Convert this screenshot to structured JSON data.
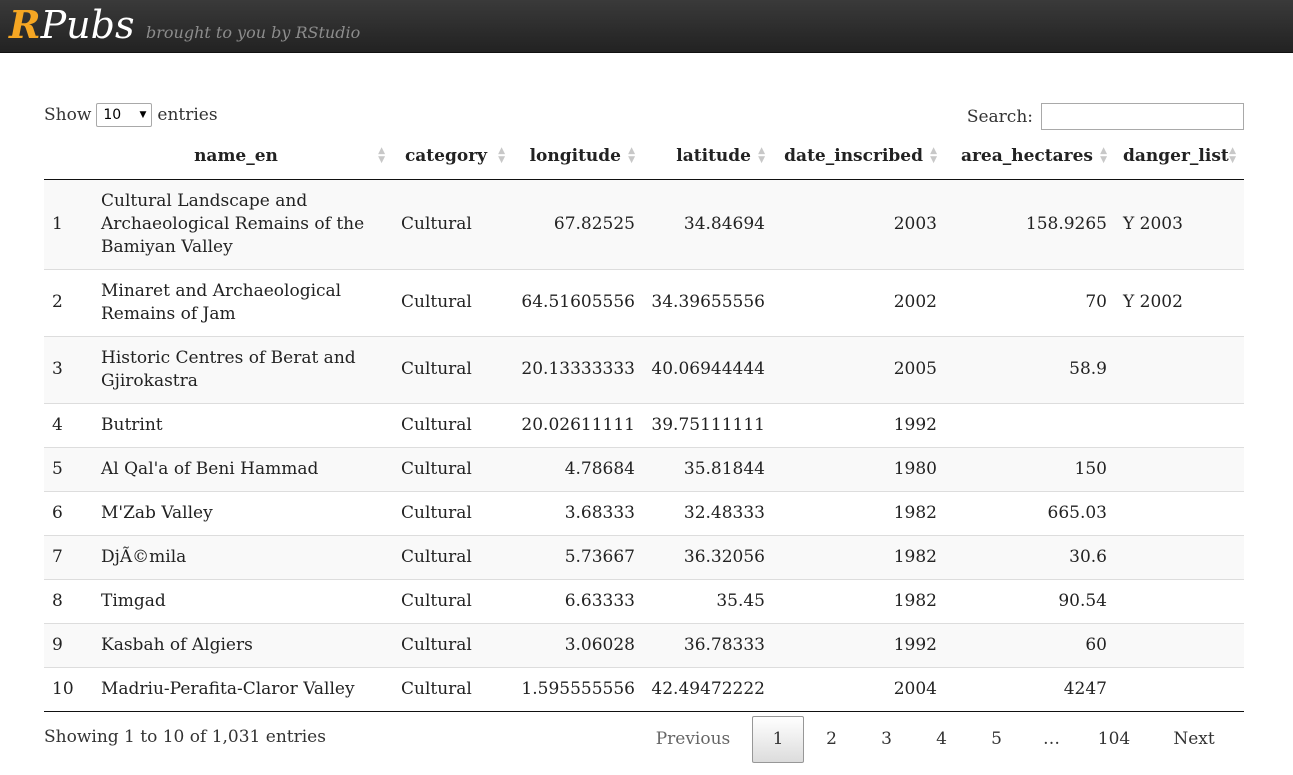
{
  "header": {
    "logo_r": "R",
    "logo_rest": "Pubs",
    "tagline": "brought to you by RStudio",
    "accent_color": "#f5a623"
  },
  "controls": {
    "show_label": "Show",
    "entries_label": "entries",
    "length_value": "10",
    "search_label": "Search:",
    "search_value": ""
  },
  "table": {
    "columns": [
      "",
      "name_en",
      "category",
      "longitude",
      "latitude",
      "date_inscribed",
      "area_hectares",
      "danger_list"
    ],
    "rows": [
      [
        "1",
        "Cultural Landscape and Archaeological Remains of the Bamiyan Valley",
        "Cultural",
        "67.82525",
        "34.84694",
        "2003",
        "158.9265",
        "Y 2003"
      ],
      [
        "2",
        "Minaret and Archaeological Remains of Jam",
        "Cultural",
        "64.51605556",
        "34.39655556",
        "2002",
        "70",
        "Y 2002"
      ],
      [
        "3",
        "Historic Centres of Berat and Gjirokastra",
        "Cultural",
        "20.13333333",
        "40.06944444",
        "2005",
        "58.9",
        ""
      ],
      [
        "4",
        "Butrint",
        "Cultural",
        "20.02611111",
        "39.75111111",
        "1992",
        "",
        ""
      ],
      [
        "5",
        "Al Qal'a of Beni Hammad",
        "Cultural",
        "4.78684",
        "35.81844",
        "1980",
        "150",
        ""
      ],
      [
        "6",
        "M'Zab Valley",
        "Cultural",
        "3.68333",
        "32.48333",
        "1982",
        "665.03",
        ""
      ],
      [
        "7",
        "DjÃ©mila",
        "Cultural",
        "5.73667",
        "36.32056",
        "1982",
        "30.6",
        ""
      ],
      [
        "8",
        "Timgad",
        "Cultural",
        "6.63333",
        "35.45",
        "1982",
        "90.54",
        ""
      ],
      [
        "9",
        "Kasbah of Algiers",
        "Cultural",
        "3.06028",
        "36.78333",
        "1992",
        "60",
        ""
      ],
      [
        "10",
        "Madriu-Perafita-Claror Valley",
        "Cultural",
        "1.595555556",
        "42.49472222",
        "2004",
        "4247",
        ""
      ]
    ]
  },
  "footer": {
    "info": "Showing 1 to 10 of 1,031 entries",
    "previous": "Previous",
    "next": "Next",
    "pages": [
      "1",
      "2",
      "3",
      "4",
      "5",
      "…",
      "104"
    ],
    "current_page": "1"
  }
}
